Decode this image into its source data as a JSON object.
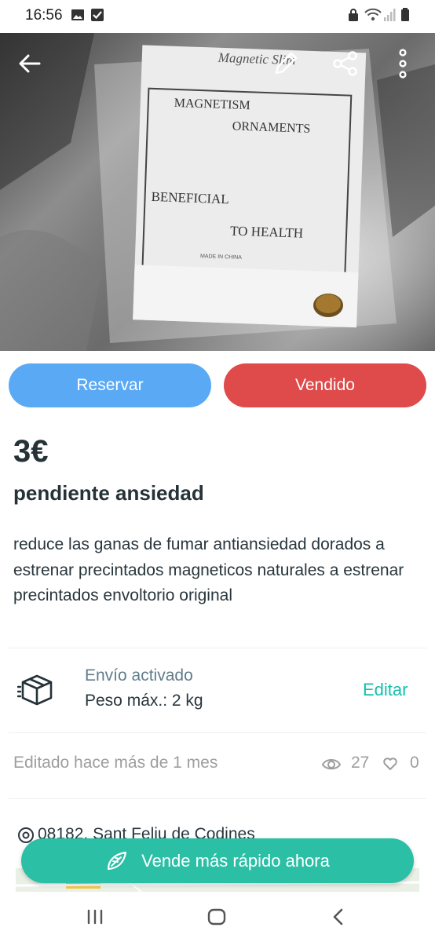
{
  "status_bar": {
    "time": "16:56"
  },
  "hero": {
    "photo_text": [
      "MAGNETISM",
      "ORNAMENTS",
      "BENEFICIAL",
      "TO HEALTH",
      "MADE IN CHINA",
      "Magnetic Slim"
    ]
  },
  "actions": {
    "reserve_label": "Reservar",
    "sold_label": "Vendido"
  },
  "product": {
    "price": "3€",
    "title": "pendiente ansiedad",
    "description": "reduce las ganas de fumar antiansiedad dorados a estrenar precintados magneticos naturales a estrenar precintados envoltorio original"
  },
  "shipping": {
    "label": "Envío activado",
    "max_weight": "Peso máx.: 2 kg",
    "edit_label": "Editar"
  },
  "stats": {
    "edited": "Editado hace más de 1 mes",
    "views": "27",
    "likes": "0"
  },
  "location": {
    "text": "08182, Sant Feliu de Codines"
  },
  "promo": {
    "label": "Vende más rápido ahora"
  },
  "colors": {
    "accent": "#13c1ac",
    "reserve": "#5aa9f5",
    "sold": "#df4a4a",
    "promo": "#2bbfa6"
  }
}
